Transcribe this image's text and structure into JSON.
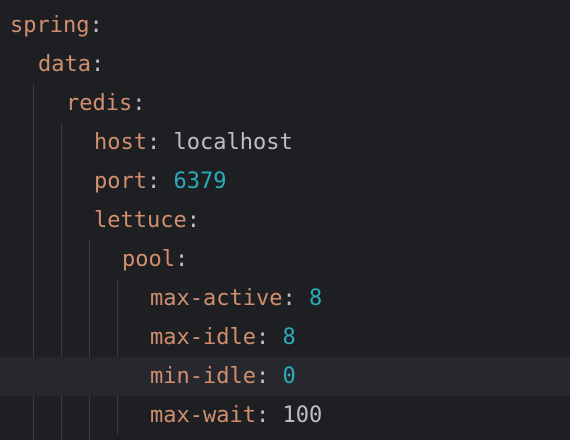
{
  "editor": {
    "lines": [
      {
        "key": "spring",
        "sep": ":",
        "value": "",
        "value_type": "none"
      },
      {
        "key": "data",
        "sep": ":",
        "value": "",
        "value_type": "none"
      },
      {
        "key": "redis",
        "sep": ":",
        "value": "",
        "value_type": "none"
      },
      {
        "key": "host",
        "sep": ": ",
        "value": "localhost",
        "value_type": "str"
      },
      {
        "key": "port",
        "sep": ": ",
        "value": "6379",
        "value_type": "num"
      },
      {
        "key": "lettuce",
        "sep": ":",
        "value": "",
        "value_type": "none"
      },
      {
        "key": "pool",
        "sep": ":",
        "value": "",
        "value_type": "none"
      },
      {
        "key": "max-active",
        "sep": ": ",
        "value": "8",
        "value_type": "num"
      },
      {
        "key": "max-idle",
        "sep": ": ",
        "value": "8",
        "value_type": "num"
      },
      {
        "key": "min-idle",
        "sep": ": ",
        "value": "0",
        "value_type": "num"
      },
      {
        "key": "max-wait",
        "sep": ": ",
        "value": "100",
        "value_type": "str"
      }
    ]
  },
  "colors": {
    "background": "#1e1f22",
    "current_line": "#26282e",
    "key": "#cf8e6d",
    "number": "#2aacb8",
    "text": "#bcbec4",
    "indent_guide": "#393b40"
  }
}
